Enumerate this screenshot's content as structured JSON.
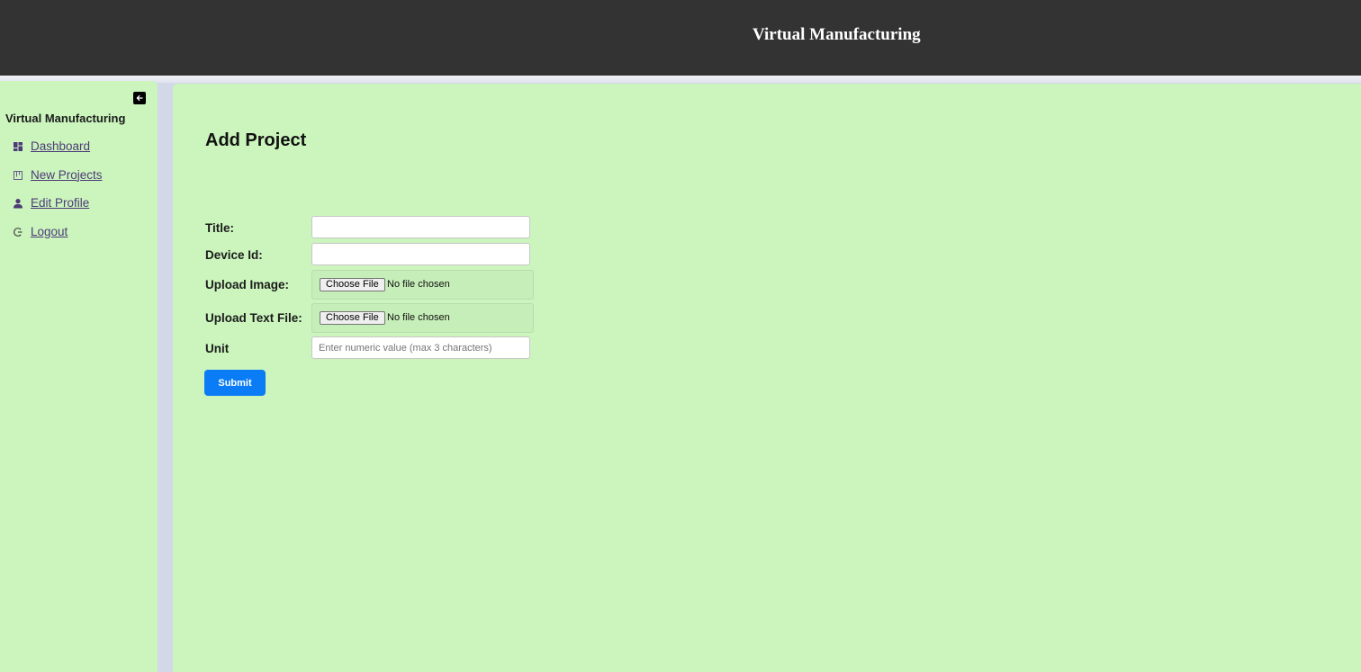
{
  "header": {
    "title": "Virtual Manufacturing"
  },
  "sidebar": {
    "title": "Virtual Manufacturing",
    "collapse_icon": "arrow-left-icon",
    "items": [
      {
        "label": "Dashboard",
        "icon": "dashboard-icon"
      },
      {
        "label": "New Projects",
        "icon": "projects-icon"
      },
      {
        "label": "Edit Profile",
        "icon": "user-icon"
      },
      {
        "label": "Logout",
        "icon": "logout-icon"
      }
    ]
  },
  "main": {
    "page_title": "Add Project",
    "form": {
      "title_label": "Title:",
      "title_value": "",
      "device_id_label": "Device Id:",
      "device_id_value": "",
      "upload_image_label": "Upload Image:",
      "upload_text_label": "Upload Text File:",
      "choose_file_label": "Choose File",
      "no_file_text": "No file chosen",
      "unit_label": "Unit",
      "unit_placeholder": "Enter numeric value (max 3 characters)",
      "submit_label": "Submit"
    }
  },
  "colors": {
    "header_bg": "#333333",
    "panel_bg": "#cbf5bd",
    "accent": "#0a7cf5",
    "link": "#4d3a78"
  }
}
